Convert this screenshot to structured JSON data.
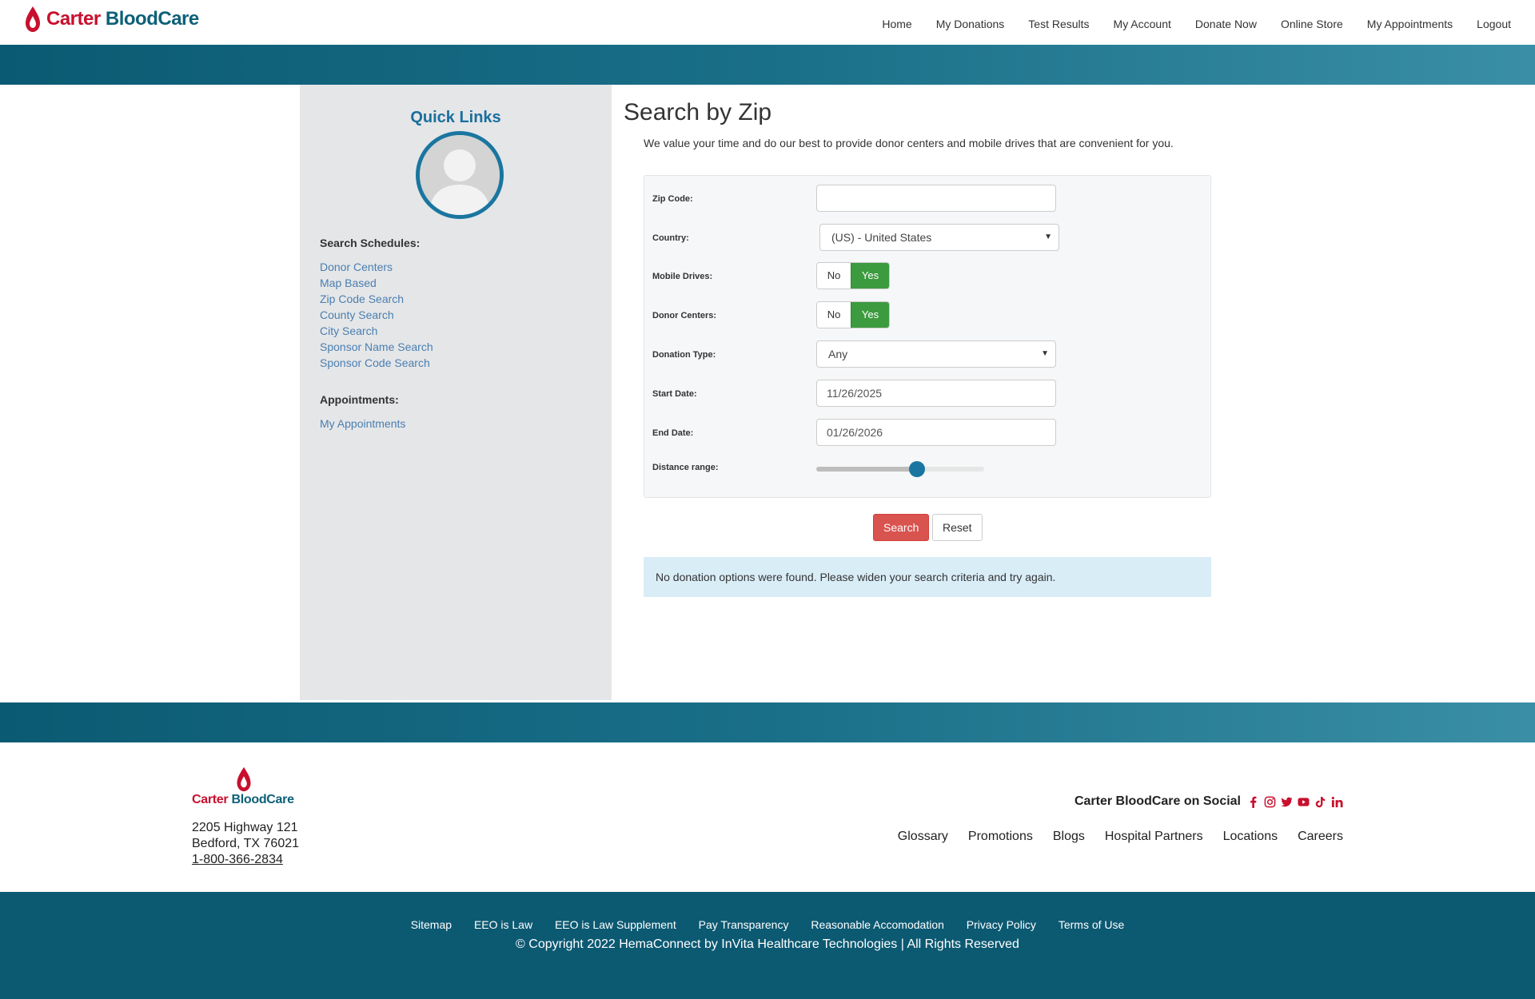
{
  "brand": {
    "name_part1": "Carter ",
    "name_part2": "BloodCare",
    "colors": {
      "red": "#c8102e",
      "teal": "#0e6078",
      "accent_blue": "#1a76a0",
      "success_green": "#3d9b3f",
      "danger_red": "#d9534f"
    }
  },
  "nav": {
    "items": [
      "Home",
      "My Donations",
      "Test Results",
      "My Account",
      "Donate Now",
      "Online Store",
      "My Appointments",
      "Logout"
    ]
  },
  "sidebar": {
    "title": "Quick Links",
    "avatar_icon": "user-avatar-icon",
    "search_heading": "Search Schedules:",
    "search_links": [
      "Donor Centers",
      "Map Based",
      "Zip Code Search",
      "County Search",
      "City Search",
      "Sponsor Name Search",
      "Sponsor Code Search"
    ],
    "appointments_heading": "Appointments:",
    "appointment_links": [
      "My Appointments"
    ]
  },
  "main": {
    "title": "Search by Zip",
    "description": "We value your time and do our best to provide donor centers and mobile drives that are convenient for you.",
    "form": {
      "zip_label": "Zip Code:",
      "zip_value": "",
      "country_label": "Country:",
      "country_value": "(US) - United States",
      "mobile_label": "Mobile Drives:",
      "donor_label": "Donor Centers:",
      "toggle_no": "No",
      "toggle_yes": "Yes",
      "donation_type_label": "Donation Type:",
      "donation_type_value": "Any",
      "start_label": "Start Date:",
      "start_value": "11/26/2025",
      "end_label": "End Date:",
      "end_value": "01/26/2026",
      "distance_label": "Distance range:",
      "distance_fraction": 0.6
    },
    "search_button": "Search",
    "reset_button": "Reset",
    "alert": "No donation options were found. Please widen your search criteria and try again."
  },
  "footer": {
    "address_line1": "2205 Highway 121",
    "address_line2": "Bedford, TX 76021",
    "phone": "1-800-366-2834",
    "social_label": "Carter BloodCare on Social",
    "social_icons": [
      "facebook-icon",
      "instagram-icon",
      "twitter-icon",
      "youtube-icon",
      "tiktok-icon",
      "linkedin-icon"
    ],
    "links": [
      "Glossary",
      "Promotions",
      "Blogs",
      "Hospital Partners",
      "Locations",
      "Careers"
    ],
    "bottom_links": [
      "Sitemap",
      "EEO is Law",
      "EEO is Law Supplement",
      "Pay Transparency",
      "Reasonable Accomodation",
      "Privacy Policy",
      "Terms of Use"
    ],
    "copyright": "© Copyright 2022 HemaConnect by InVita Healthcare Technologies | All Rights Reserved"
  }
}
